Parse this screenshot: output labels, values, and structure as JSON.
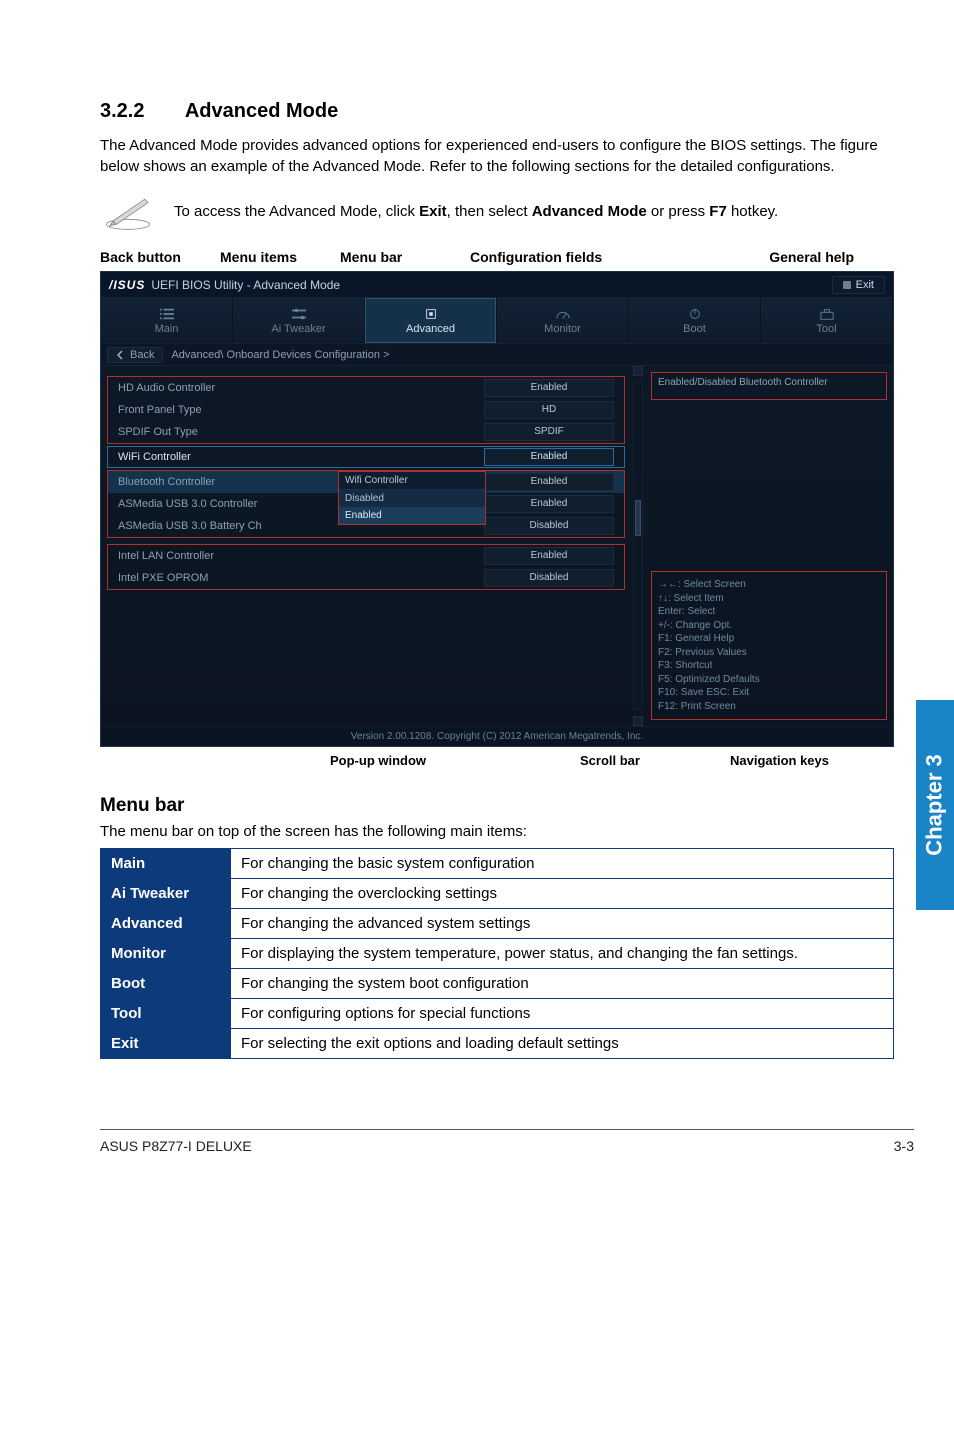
{
  "section": {
    "number": "3.2.2",
    "title": "Advanced Mode"
  },
  "intro": "The Advanced Mode provides advanced options for experienced end-users to configure the BIOS settings. The figure below shows an example of the Advanced Mode. Refer to the following sections for the detailed configurations.",
  "note": {
    "pre": "To access the Advanced Mode, click ",
    "b1": "Exit",
    "mid": ", then select ",
    "b2": "Advanced Mode",
    "post": " or press ",
    "b3": "F7",
    "end": " hotkey."
  },
  "topLabels": {
    "back": "Back button",
    "items": "Menu items",
    "bar": "Menu bar",
    "fields": "Configuration fields",
    "help": "General help"
  },
  "bios": {
    "logo": "/ISUS",
    "title": "UEFI BIOS Utility - Advanced Mode",
    "exit": "Exit",
    "tabs": [
      "Main",
      "Ai Tweaker",
      "Advanced",
      "Monitor",
      "Boot",
      "Tool"
    ],
    "back": "Back",
    "crumb": "Advanced\\ Onboard Devices Configuration >",
    "options": [
      {
        "label": "HD Audio Controller",
        "value": "Enabled"
      },
      {
        "label": "Front Panel Type",
        "value": "HD"
      },
      {
        "label": "SPDIF Out Type",
        "value": "SPDIF"
      },
      {
        "label": "WiFi Controller",
        "value": "Enabled",
        "hi": true
      },
      {
        "label": "Bluetooth Controller",
        "value": "Enabled",
        "sel": true
      },
      {
        "label": "ASMedia USB 3.0 Controller",
        "value": "Enabled"
      },
      {
        "label": "ASMedia USB 3.0 Battery Ch",
        "value": "Disabled"
      },
      {
        "label": "Intel LAN Controller",
        "value": "Enabled"
      },
      {
        "label": "Intel PXE OPROM",
        "value": "Disabled"
      }
    ],
    "popup": {
      "title": "Wifi Controller",
      "items": [
        "Disabled",
        "Enabled"
      ]
    },
    "help": "Enabled/Disabled Bluetooth Controller",
    "nav": [
      "→←: Select Screen",
      "↑↓: Select Item",
      "Enter: Select",
      "+/-: Change Opt.",
      "F1: General Help",
      "F2: Previous Values",
      "F3: Shortcut",
      "F5: Optimized Defaults",
      "F10: Save  ESC: Exit",
      "F12: Print Screen"
    ],
    "footer": "Version 2.00.1208.  Copyright (C) 2012 American Megatrends, Inc."
  },
  "figLabels": {
    "popup": "Pop-up window",
    "scroll": "Scroll bar",
    "nav": "Navigation keys"
  },
  "menubar": {
    "heading": "Menu bar",
    "desc": "The menu bar on top of the screen has the following main items:",
    "rows": [
      {
        "k": "Main",
        "v": "For changing the basic system configuration"
      },
      {
        "k": "Ai Tweaker",
        "v": "For changing the overclocking settings"
      },
      {
        "k": "Advanced",
        "v": "For changing the advanced system settings"
      },
      {
        "k": "Monitor",
        "v": "For displaying the system temperature, power status, and changing the fan settings."
      },
      {
        "k": "Boot",
        "v": "For changing the system boot configuration"
      },
      {
        "k": "Tool",
        "v": "For configuring options for special functions"
      },
      {
        "k": "Exit",
        "v": "For selecting the exit options and loading default settings"
      }
    ]
  },
  "sideTab": "Chapter 3",
  "footer": {
    "left": "ASUS P8Z77-I DELUXE",
    "right": "3-3"
  }
}
